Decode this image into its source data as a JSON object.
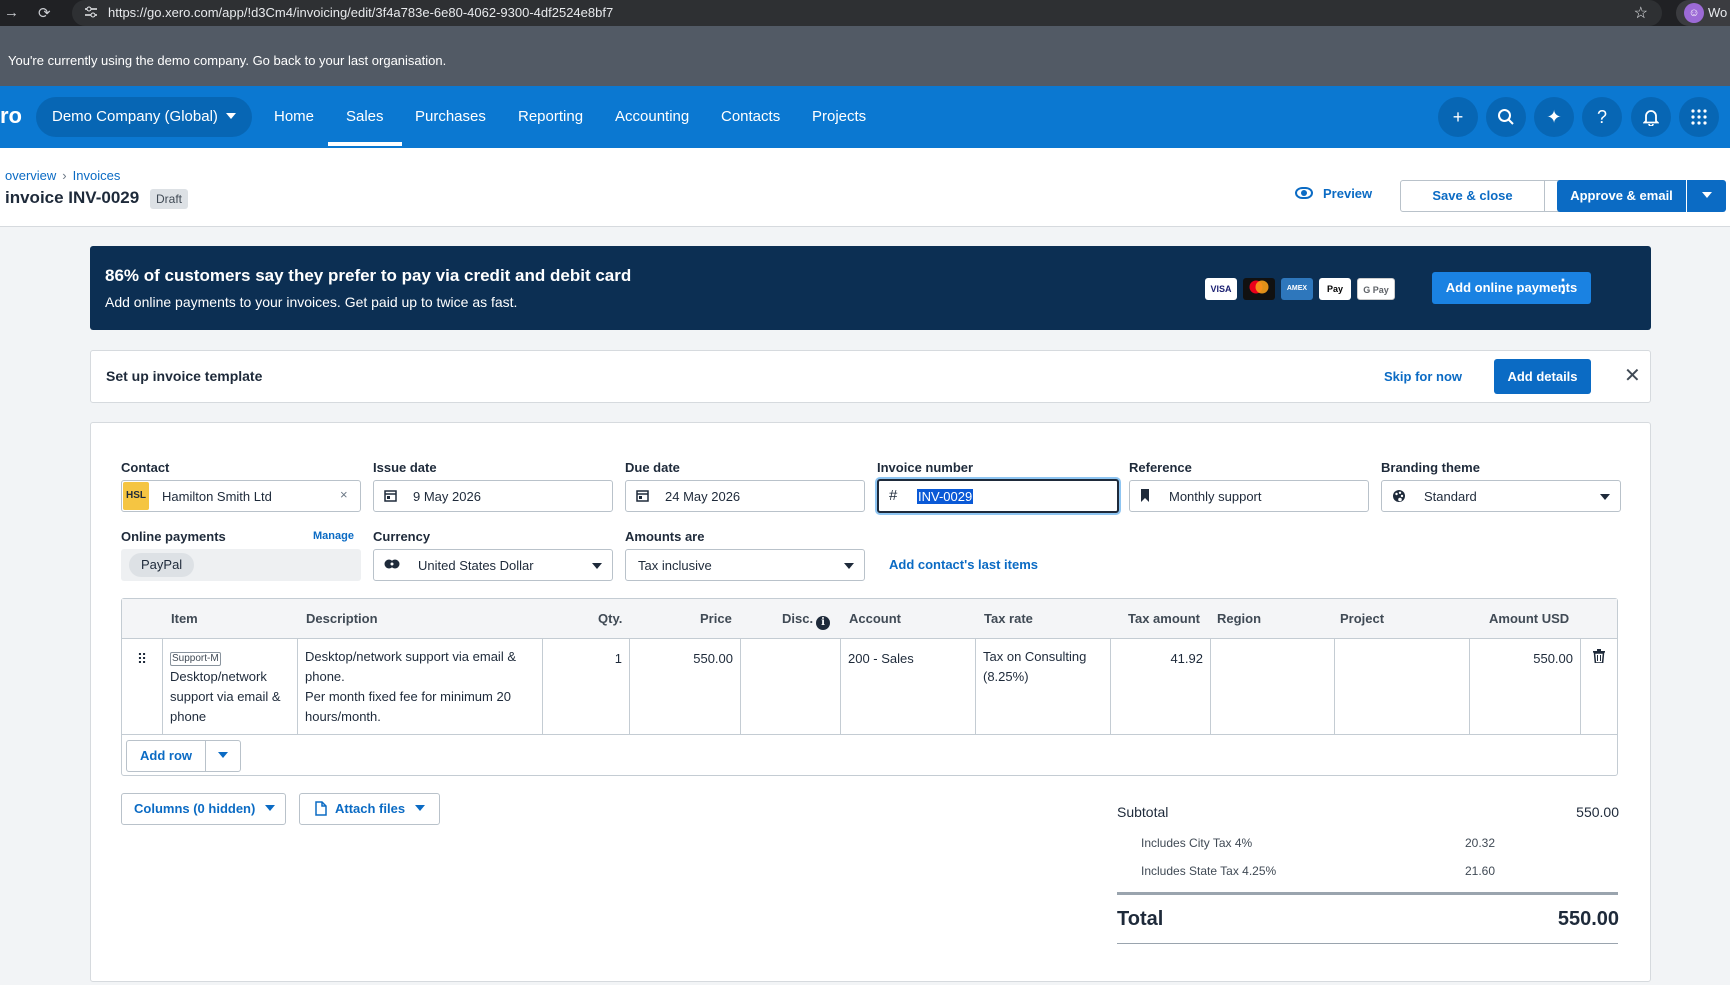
{
  "browser": {
    "url": "https://go.xero.com/app/!d3Cm4/invoicing/edit/3f4a783e-6e80-4062-9300-4df2524e8bf7",
    "profile_label": "Wo"
  },
  "demo_banner": "You're currently using the demo company. Go back to your last organisation.",
  "topnav": {
    "logo": "ro",
    "org": "Demo Company (Global)",
    "items": [
      "Home",
      "Sales",
      "Purchases",
      "Reporting",
      "Accounting",
      "Contacts",
      "Projects"
    ],
    "active": "Sales",
    "icons": [
      "plus-icon",
      "search-icon",
      "sparkle-icon",
      "help-icon",
      "bell-icon",
      "apps-icon"
    ]
  },
  "page": {
    "breadcrumb": [
      "overview",
      "Invoices"
    ],
    "title": "invoice INV-0029",
    "status": "Draft",
    "preview": "Preview",
    "save_close": "Save & close",
    "approve_email": "Approve & email"
  },
  "promo": {
    "heading": "86% of customers say they prefer to pay via credit and debit card",
    "subtext": "Add online payments to your invoices. Get paid up to twice as fast.",
    "cards": [
      "VISA",
      "MC",
      "AMEX",
      "Pay",
      "G Pay"
    ],
    "button": "Add online payments"
  },
  "template_bar": {
    "title": "Set up invoice template",
    "skip": "Skip for now",
    "add": "Add details"
  },
  "form": {
    "contact_label": "Contact",
    "contact_initials": "HSL",
    "contact_value": "Hamilton Smith Ltd",
    "issue_label": "Issue date",
    "issue_value": "9 May 2026",
    "due_label": "Due date",
    "due_value": "24 May 2026",
    "invnum_label": "Invoice number",
    "invnum_value": "INV-0029",
    "ref_label": "Reference",
    "ref_value": "Monthly support",
    "brand_label": "Branding theme",
    "brand_value": "Standard",
    "online_label": "Online payments",
    "manage": "Manage",
    "paypal": "PayPal",
    "currency_label": "Currency",
    "currency_value": "United States Dollar",
    "amounts_label": "Amounts are",
    "amounts_value": "Tax inclusive",
    "add_last_items": "Add contact's last items"
  },
  "table": {
    "headers": {
      "item": "Item",
      "description": "Description",
      "qty": "Qty.",
      "price": "Price",
      "disc": "Disc.",
      "account": "Account",
      "tax_rate": "Tax rate",
      "tax_amount": "Tax amount",
      "region": "Region",
      "project": "Project",
      "amount": "Amount USD"
    },
    "row": {
      "item_code": "Support-M",
      "item_name": "Desktop/network support via email & phone",
      "description_1": "Desktop/network support via email & phone.",
      "description_2": "Per month fixed fee for minimum 20 hours/month.",
      "qty": "1",
      "price": "550.00",
      "account": "200 - Sales",
      "tax_rate": "Tax on Consulting (8.25%)",
      "tax_amount": "41.92",
      "amount": "550.00"
    },
    "add_row": "Add row"
  },
  "footer_buttons": {
    "columns": "Columns (0 hidden)",
    "attach": "Attach files"
  },
  "totals": {
    "subtotal_label": "Subtotal",
    "subtotal": "550.00",
    "city_label": "Includes City Tax 4%",
    "city": "20.32",
    "state_label": "Includes State Tax 4.25%",
    "state": "21.60",
    "total_label": "Total",
    "total": "550.00"
  }
}
